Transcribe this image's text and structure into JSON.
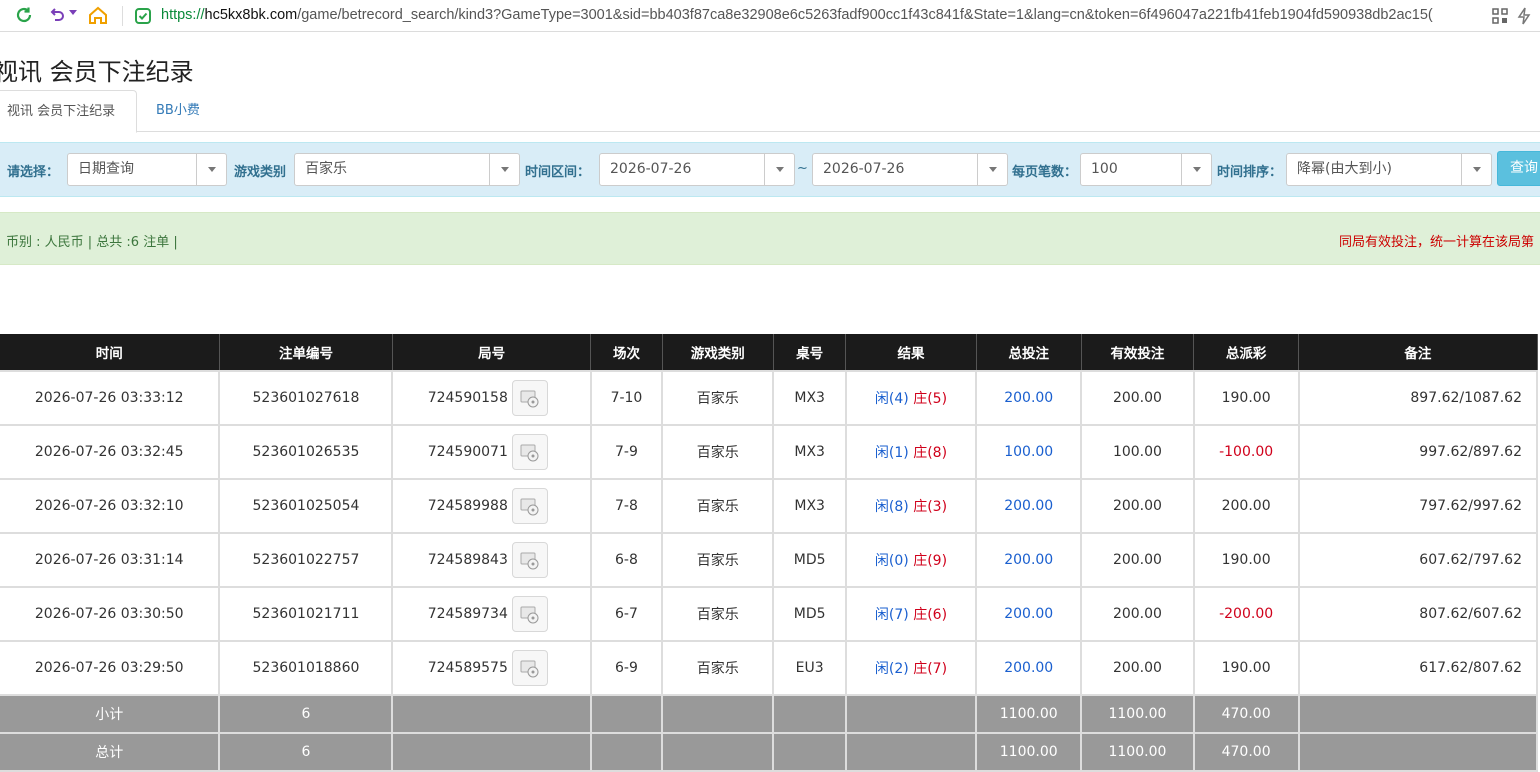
{
  "browser": {
    "url_scheme": "https://",
    "url_host": "hc5kx8bk.com",
    "url_rest": "/game/betrecord_search/kind3?GameType=3001&sid=bb403f87ca8e32908e6c5263fadf900cc1f43c841f&State=1&lang=cn&token=6f496047a221fb41feb1904fd590938db2ac15("
  },
  "page": {
    "title": "视讯 会员下注纪录"
  },
  "tabs": [
    {
      "label": "视讯 会员下注纪录"
    },
    {
      "label": "BB小费"
    }
  ],
  "filters": {
    "select_label": "请选择：",
    "select_value": "日期查询",
    "game_label": "游戏类别",
    "game_value": "百家乐",
    "range_label": "时间区间：",
    "date_from": "2026-07-26",
    "tilde": "~",
    "date_to": "2026-07-26",
    "per_page_label": "每页笔数：",
    "per_page_value": "100",
    "sort_label": "时间排序：",
    "sort_value": "降幂(由大到小)",
    "query_label": "查询"
  },
  "summary": {
    "left": "币别 : 人民币 | 总共 :6 注单 |",
    "right": "同局有效投注，统一计算在该局第"
  },
  "table": {
    "headers": [
      "时间",
      "注单编号",
      "局号",
      "场次",
      "游戏类别",
      "桌号",
      "结果",
      "总投注",
      "有效投注",
      "总派彩",
      "备注"
    ],
    "rows": [
      {
        "time": "2026-07-26 03:33:12",
        "bet_no": "523601027618",
        "round": "724590158",
        "session": "7-10",
        "game": "百家乐",
        "table": "MX3",
        "player": "闲(4)",
        "banker": "庄(5)",
        "total_bet": "200.00",
        "valid_bet": "200.00",
        "payout": "190.00",
        "note": "897.62/1087.62"
      },
      {
        "time": "2026-07-26 03:32:45",
        "bet_no": "523601026535",
        "round": "724590071",
        "session": "7-9",
        "game": "百家乐",
        "table": "MX3",
        "player": "闲(1)",
        "banker": "庄(8)",
        "total_bet": "100.00",
        "valid_bet": "100.00",
        "payout": "-100.00",
        "note": "997.62/897.62"
      },
      {
        "time": "2026-07-26 03:32:10",
        "bet_no": "523601025054",
        "round": "724589988",
        "session": "7-8",
        "game": "百家乐",
        "table": "MX3",
        "player": "闲(8)",
        "banker": "庄(3)",
        "total_bet": "200.00",
        "valid_bet": "200.00",
        "payout": "200.00",
        "note": "797.62/997.62"
      },
      {
        "time": "2026-07-26 03:31:14",
        "bet_no": "523601022757",
        "round": "724589843",
        "session": "6-8",
        "game": "百家乐",
        "table": "MD5",
        "player": "闲(0)",
        "banker": "庄(9)",
        "total_bet": "200.00",
        "valid_bet": "200.00",
        "payout": "190.00",
        "note": "607.62/797.62"
      },
      {
        "time": "2026-07-26 03:30:50",
        "bet_no": "523601021711",
        "round": "724589734",
        "session": "6-7",
        "game": "百家乐",
        "table": "MD5",
        "player": "闲(7)",
        "banker": "庄(6)",
        "total_bet": "200.00",
        "valid_bet": "200.00",
        "payout": "-200.00",
        "note": "807.62/607.62"
      },
      {
        "time": "2026-07-26 03:29:50",
        "bet_no": "523601018860",
        "round": "724589575",
        "session": "6-9",
        "game": "百家乐",
        "table": "EU3",
        "player": "闲(2)",
        "banker": "庄(7)",
        "total_bet": "200.00",
        "valid_bet": "200.00",
        "payout": "190.00",
        "note": "617.62/807.62"
      }
    ],
    "subtotal": {
      "label": "小计",
      "count": "6",
      "total_bet": "1100.00",
      "valid_bet": "1100.00",
      "payout": "470.00"
    },
    "total": {
      "label": "总计",
      "count": "6",
      "total_bet": "1100.00",
      "valid_bet": "1100.00",
      "payout": "470.00"
    }
  },
  "colors": {
    "header_bg": "#1b1b1b",
    "positive_blue": "#1a5fcf",
    "negative_red": "#d0011b",
    "filter_bg": "#d9edf7",
    "summary_bg": "#dff0d8"
  },
  "icons": [
    "reload-icon",
    "undo-icon",
    "home-icon",
    "shield-icon",
    "qr-icon",
    "bolt-icon",
    "film-icon"
  ]
}
